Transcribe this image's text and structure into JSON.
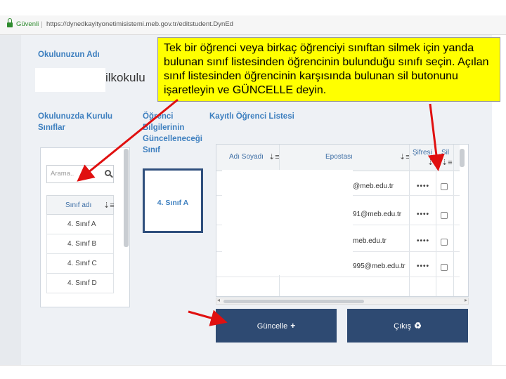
{
  "browser": {
    "secure_label": "Güvenli",
    "separator": "|",
    "url": "https://dynedkayityonetimisistemi.meb.gov.tr/editstudent.DynEd"
  },
  "form": {
    "school_label": "Okulunuzun Adı",
    "school_name_suffix": "ilkokulu",
    "classes_label": "Okulunuzda Kurulu Sınıflar",
    "update_class_label": "Öğrenci Bilgilerinin Güncelleneceği Sınıf",
    "students_label": "Kayıtlı Öğrenci Listesi"
  },
  "class_list": {
    "search_placeholder": "Arama..",
    "header": "Sınıf adı",
    "items": [
      "4. Sınıf A",
      "4. Sınıf B",
      "4. Sınıf C",
      "4. Sınıf D"
    ]
  },
  "selected_class": "4. Sınıf A",
  "students": {
    "headers": {
      "name": "Adı Soyadı",
      "email": "Epostası",
      "password": "Şifresi",
      "delete": "Sil"
    },
    "rows": [
      {
        "email": "@meb.edu.tr",
        "password": "••••"
      },
      {
        "email": "91@meb.edu.tr",
        "password": "••••"
      },
      {
        "email": "meb.edu.tr",
        "password": "••••"
      },
      {
        "email": "995@meb.edu.tr",
        "password": "••••"
      }
    ]
  },
  "buttons": {
    "update": "Güncelle",
    "update_icon": "+",
    "exit": "Çıkış",
    "exit_icon": "♻"
  },
  "tooltip": "Tek bir öğrenci veya birkaç öğrenciyi sınıftan silmek için yanda bulunan sınıf listesinden öğrencinin bulunduğu sınıfı seçin. Açılan sınıf listesinden öğrencinin karşısında bulunan sil butonunu işaretleyin ve GÜNCELLE deyin.",
  "colors": {
    "label_blue": "#3d7fbf",
    "button_navy": "#2e4a72",
    "tooltip_yellow": "#ffff00",
    "arrow_red": "#e01010"
  }
}
